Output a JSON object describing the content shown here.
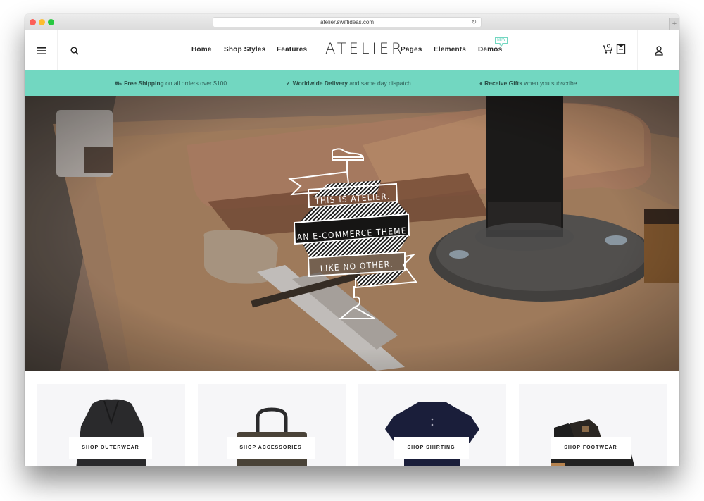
{
  "browser": {
    "url": "atelier.swiftideas.com",
    "reload_icon": "reload-icon",
    "new_tab_icon": "plus-icon"
  },
  "header": {
    "logo": "ATELIER",
    "nav_left": [
      {
        "label": "Home"
      },
      {
        "label": "Shop Styles"
      },
      {
        "label": "Features"
      }
    ],
    "nav_right": [
      {
        "label": "Pages"
      },
      {
        "label": "Elements"
      },
      {
        "label": "Demos",
        "badge": "NEW"
      }
    ],
    "cart_count": "0",
    "icons": [
      "menu-icon",
      "search-icon",
      "cart-icon",
      "wishlist-icon",
      "account-icon"
    ]
  },
  "promo_bar": {
    "background": "#72d7c1",
    "items": [
      {
        "icon": "truck-icon",
        "bold": "Free Shipping",
        "text": " on all orders over $100."
      },
      {
        "icon": "check-icon",
        "bold": "Worldwide Delivery",
        "text": " and same day dispatch."
      },
      {
        "icon": "diamond-icon",
        "bold": "Receive Gifts",
        "text": " when you subscribe."
      }
    ]
  },
  "hero": {
    "lines": [
      "THIS IS ATELIER.",
      "AN E-COMMERCE THEME",
      "LIKE NO OTHER."
    ],
    "top_icon": "sneaker-icon",
    "bottom_icon": "hanger-icon"
  },
  "categories": [
    {
      "label": "SHOP OUTERWEAR",
      "image": "coat"
    },
    {
      "label": "SHOP ACCESSORIES",
      "image": "bag"
    },
    {
      "label": "SHOP SHIRTING",
      "image": "polo-shirt"
    },
    {
      "label": "SHOP FOOTWEAR",
      "image": "boots"
    }
  ]
}
